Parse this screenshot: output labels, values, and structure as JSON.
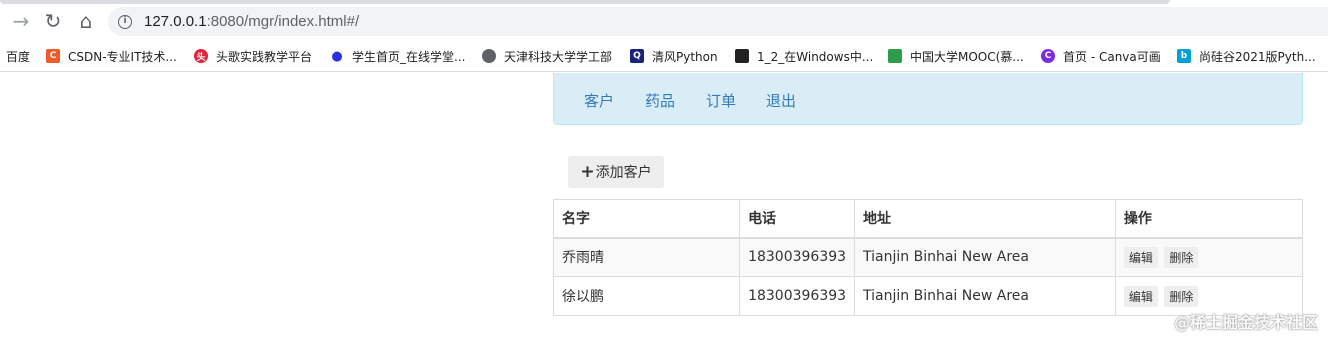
{
  "browser": {
    "url_host": "127.0.0.1",
    "url_rest": ":8080/mgr/index.html#/"
  },
  "bookmarks": [
    {
      "label": "百度",
      "icon": "baidu-icon",
      "color": "#ffffff"
    },
    {
      "label": "CSDN-专业IT技术...",
      "icon": "csdn-icon",
      "color": "#f15a2b"
    },
    {
      "label": "头歌实践教学平台",
      "icon": "educoder-icon",
      "color": "#e0243a"
    },
    {
      "label": "学生首页_在线学堂...",
      "icon": "paw-icon",
      "color": "#2932e1"
    },
    {
      "label": "天津科技大学学工部",
      "icon": "globe-icon",
      "color": "#5f6368"
    },
    {
      "label": "清风Python",
      "icon": "qingfeng-icon",
      "color": "#1a237e"
    },
    {
      "label": "1_2_在Windows中...",
      "icon": "book-icon",
      "color": "#222222"
    },
    {
      "label": "中国大学MOOC(慕...",
      "icon": "mooc-icon",
      "color": "#2e9a4c"
    },
    {
      "label": "首页 - Canva可画",
      "icon": "canva-icon",
      "color": "#7d2ae8"
    },
    {
      "label": "尚硅谷2021版Pyth...",
      "icon": "bilibili-icon",
      "color": "#00a1d6"
    }
  ],
  "nav": {
    "customers": "客户",
    "medicines": "药品",
    "orders": "订单",
    "logout": "退出"
  },
  "add_button_label": "添加客户",
  "table": {
    "headers": [
      "名字",
      "电话",
      "地址",
      "操作"
    ],
    "rows": [
      {
        "name": "乔雨晴",
        "phone": "18300396393",
        "address": "Tianjin Binhai New Area",
        "edit": "编辑",
        "delete": "删除"
      },
      {
        "name": "徐以鹏",
        "phone": "18300396393",
        "address": "Tianjin Binhai New Area",
        "edit": "编辑",
        "delete": "删除"
      }
    ]
  },
  "watermark": "@稀土掘金技术社区"
}
